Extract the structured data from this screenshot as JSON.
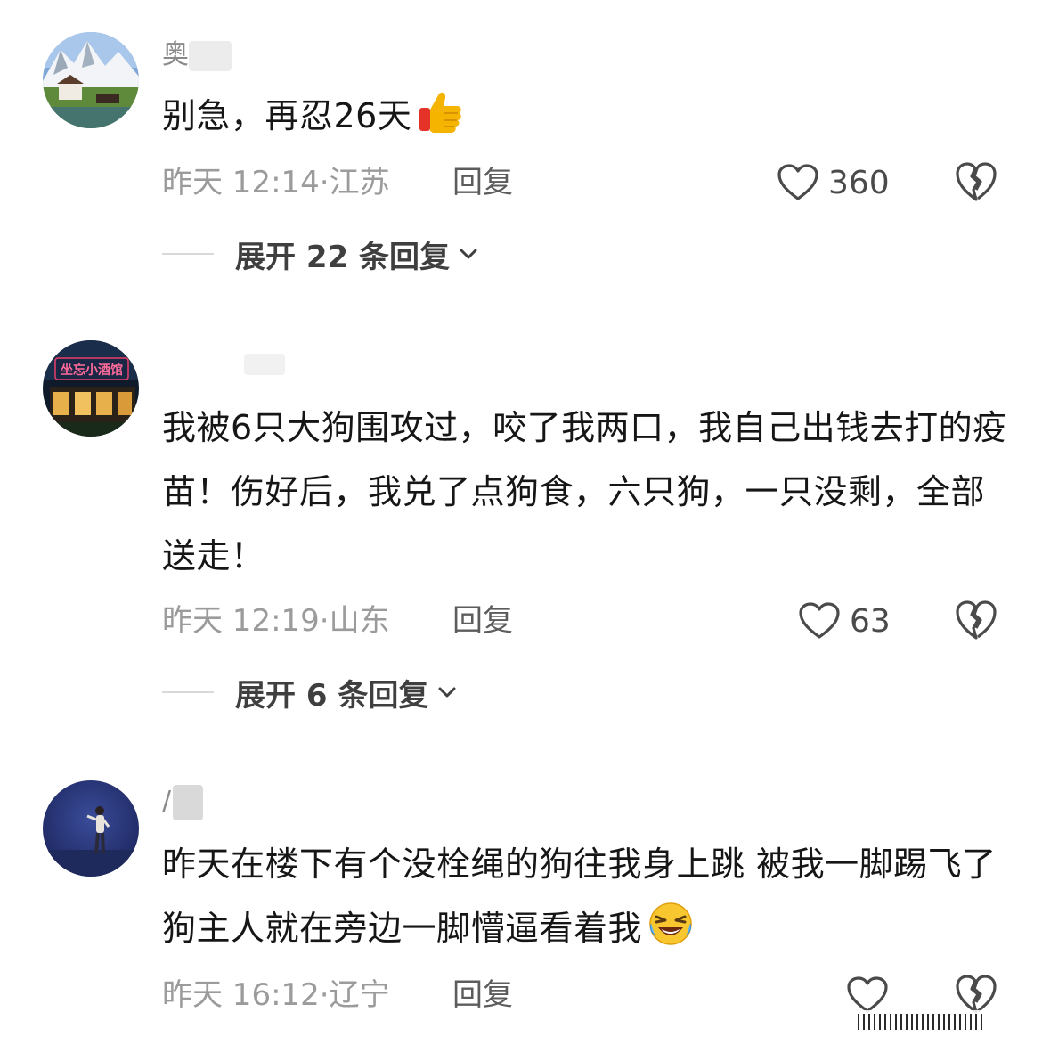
{
  "comments": [
    {
      "username": "奥",
      "text": "别急，再忍26天",
      "emoji_icon": "thumbs-up-icon",
      "time": "昨天 12:14",
      "location": "江苏",
      "reply_label": "回复",
      "likes": "360",
      "expand_label": "展开 22 条回复"
    },
    {
      "username": "",
      "avatar_sign": "坐忘小酒馆",
      "text": "我被6只大狗围攻过，咬了我两口，我自己出钱去打的疫苗！伤好后，我兑了点狗食，六只狗，一只没剩，全部送走！",
      "time": "昨天 12:19",
      "location": "山东",
      "reply_label": "回复",
      "likes": "63",
      "expand_label": "展开 6 条回复"
    },
    {
      "username": "/",
      "text": "昨天在楼下有个没栓绳的狗往我身上跳 被我一脚踢飞了 狗主人就在旁边一脚懵逼看着我",
      "emoji_icon": "rofl-emoji-icon",
      "time": "昨天 16:12",
      "location": "辽宁",
      "reply_label": "回复"
    }
  ],
  "colors": {
    "text": "#161616",
    "meta": "#9b9b9b",
    "icon": "#4a4a4a",
    "thumbs_up": "#f5b400",
    "thumbs_cuff": "#e5332a"
  }
}
